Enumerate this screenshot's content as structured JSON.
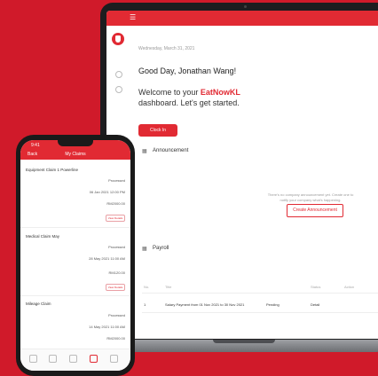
{
  "laptop": {
    "header_right": "",
    "date": "Wednesday, March 31, 2021",
    "greeting": "Good Day, Jonathan Wang!",
    "welcome_pre": "Welcome to your ",
    "brand": "EatNowKL",
    "welcome_post": " dashboard. Let's get started.",
    "primary_button": "Clock In",
    "announcement": {
      "title": "Announcement",
      "empty_text": "There's no company announcement yet. Create one to notify your company what's happening.",
      "create_button": "Create Announcement"
    },
    "payroll": {
      "title": "Payroll",
      "columns": [
        "No.",
        "Title",
        "",
        "Status",
        "Action"
      ],
      "rows": [
        {
          "no": "1",
          "title": "Salary Payment from 01 Nov 2021 to 30 Nov 2021",
          "status": "Pending",
          "action": "Detail"
        }
      ]
    }
  },
  "phone": {
    "time": "9:41",
    "back": "Back",
    "title": "My Claims",
    "items": [
      {
        "name": "Equipment Claim 1 Powerline",
        "status": "Processed",
        "date": "06 Jan 2021 12:00 PM",
        "amount": "RM2000.00",
        "button": "View Details"
      },
      {
        "name": "Medical Claim May",
        "status": "Processed",
        "date": "28 May 2021 11:00 AM",
        "amount": "RM120.00",
        "button": "View Details"
      },
      {
        "name": "Mileage Claim",
        "status": "Processed",
        "date": "14 May 2021 11:00 AM",
        "amount": "RM2000.00",
        "button": ""
      }
    ]
  }
}
